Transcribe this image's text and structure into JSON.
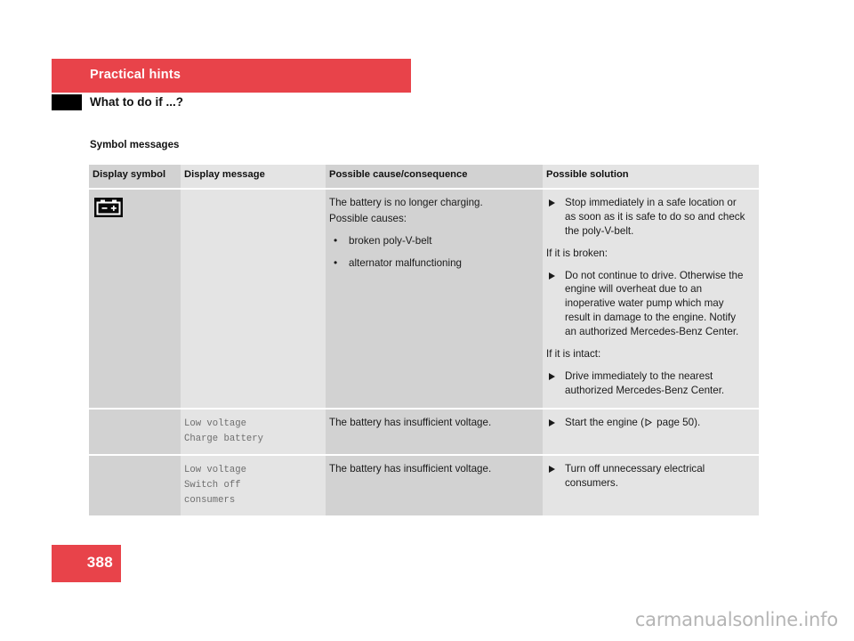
{
  "header": {
    "chapter_title": "Practical hints",
    "section_title": "What to do if ...?",
    "accent_color": "#e8434a",
    "marker_color": "#000000"
  },
  "subheading": "Symbol messages",
  "table": {
    "columns": [
      {
        "key": "display_symbol",
        "label": "Display symbol"
      },
      {
        "key": "display_message",
        "label": "Display message"
      },
      {
        "key": "possible_cause",
        "label": "Possible cause/consequence"
      },
      {
        "key": "possible_solution",
        "label": "Possible solution"
      }
    ],
    "rows": [
      {
        "symbol_icon": "battery-icon",
        "display_message": "",
        "cause": {
          "intro_line1": "The battery is no longer charging.",
          "intro_line2": "Possible causes:",
          "bullets": [
            "broken poly-V-belt",
            "alternator malfunctioning"
          ]
        },
        "solution": {
          "action_1": "Stop immediately in a safe location or as soon as it is safe to do so and check the poly-V-belt.",
          "condition_1": "If it is broken:",
          "action_2": "Do not continue to drive. Otherwise the engine will overheat due to an inoperative water pump which may result in damage to the engine. Notify an authorized Mercedes-Benz Center.",
          "condition_2": "If it is intact:",
          "action_3": "Drive immediately to the nearest authorized Mercedes-Benz Center."
        }
      },
      {
        "symbol_icon": "",
        "display_message": "Low voltage\nCharge battery",
        "cause_text": "The battery has insufficient voltage.",
        "solution_prefix": "Start the engine (",
        "solution_ref": " page 50",
        "solution_suffix": ")."
      },
      {
        "symbol_icon": "",
        "display_message": "Low voltage\nSwitch off\nconsumers",
        "cause_text": "The battery has insufficient voltage.",
        "solution_text": "Turn off unnecessary electrical consumers."
      }
    ]
  },
  "footer": {
    "page_number": "388",
    "watermark": "carmanualsonline.info"
  }
}
